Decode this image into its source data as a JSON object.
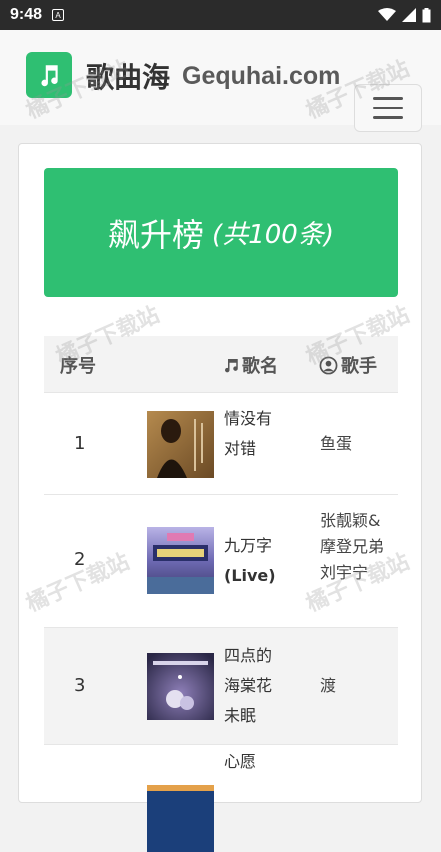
{
  "status_bar": {
    "time": "9:48",
    "notif_letter": "A"
  },
  "header": {
    "site_name": "歌曲海",
    "site_domain": "Gequhai.com",
    "logo_icon": "music-note-icon",
    "menu_icon": "hamburger-icon"
  },
  "banner": {
    "title": "飙升榜",
    "count": "(共100条)"
  },
  "table": {
    "headers": {
      "index": "序号",
      "song": "歌名",
      "artist": "歌手"
    },
    "rows": [
      {
        "index": "1",
        "song_lines": [
          "情没有",
          "对错"
        ],
        "artist": "鱼蛋"
      },
      {
        "index": "2",
        "song_lines": [
          "九万字",
          "(Live)"
        ],
        "artist": "张靓颖&摩登兄弟刘宇宁"
      },
      {
        "index": "3",
        "song_lines": [
          "四点的",
          "海棠花",
          "未眠"
        ],
        "artist": "渡"
      },
      {
        "index": "",
        "song_lines": [
          "心愿"
        ],
        "artist": ""
      }
    ]
  },
  "watermark": "橘子下载站",
  "colors": {
    "accent": "#2fbf72",
    "status_bar": "#2b2b2b"
  }
}
